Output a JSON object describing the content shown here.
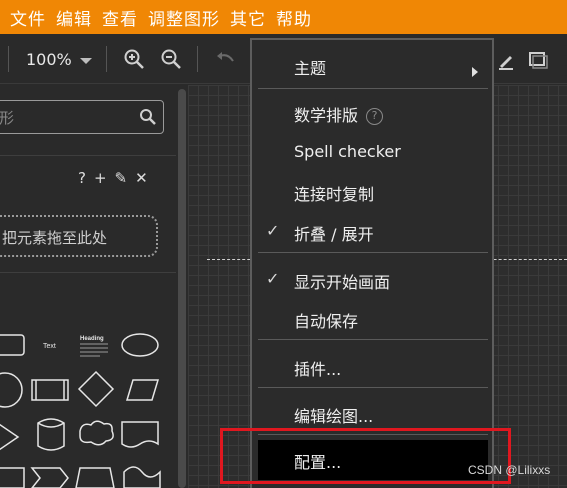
{
  "menubar": {
    "items": [
      "文件",
      "编辑",
      "查看",
      "调整图形",
      "其它",
      "帮助"
    ]
  },
  "toolbar": {
    "zoom": "100%",
    "icons": [
      "zoom-in-icon",
      "zoom-out-icon",
      "undo-icon",
      "edit-icon",
      "shape-icon"
    ]
  },
  "sidebar": {
    "search_placeholder": "形",
    "tools": [
      "?",
      "+",
      "✎",
      "✕"
    ],
    "drop_zone": "把元素拖至此处",
    "shape_labels": [
      "Text",
      "Heading"
    ]
  },
  "dropdown": {
    "theme": "主题",
    "math": "数学排版",
    "spell": "Spell checker",
    "copy_connect": "连接时复制",
    "collapse": "折叠 / 展开",
    "show_start": "显示开始画面",
    "autosave": "自动保存",
    "plugins": "插件...",
    "edit_diagram": "编辑绘图...",
    "configure": "配置..."
  },
  "watermark": "CSDN @Lilixxs",
  "colors": {
    "menubar": "#f08705",
    "highlight": "#e0171f"
  }
}
